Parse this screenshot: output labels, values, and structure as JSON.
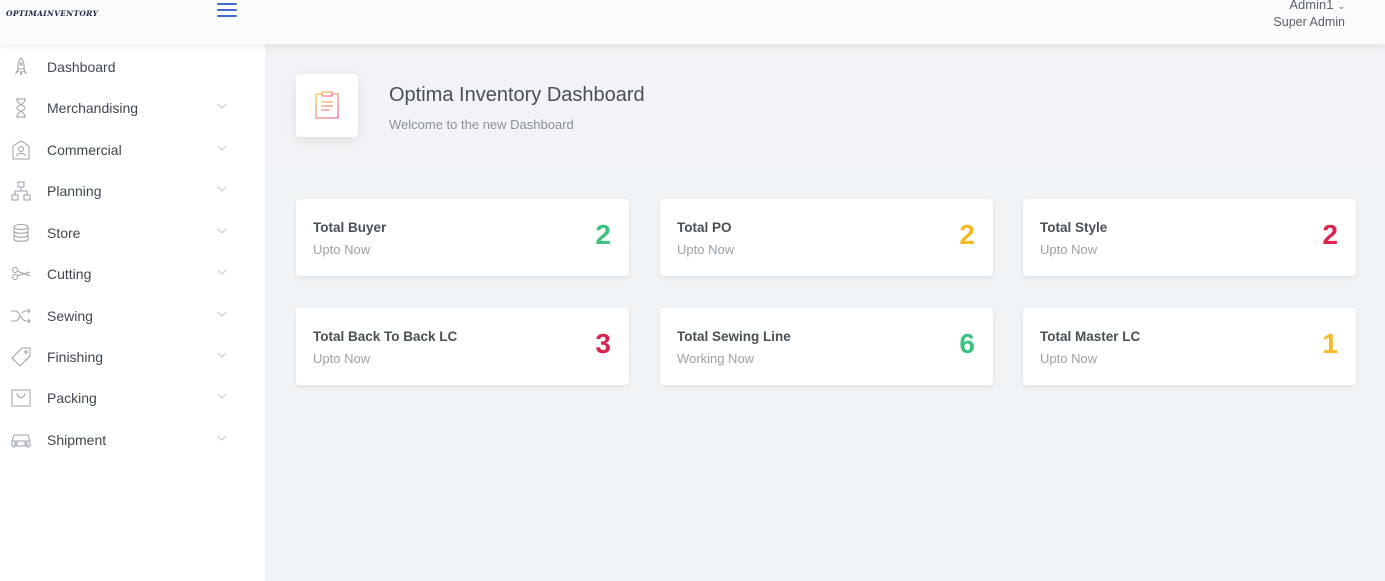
{
  "header": {
    "logo_text": "OPTIMAINVENTORY",
    "user_name": "Admin1",
    "user_role": "Super Admin"
  },
  "sidebar": {
    "items": [
      {
        "label": "Dashboard",
        "icon": "rocket-icon",
        "expandable": false
      },
      {
        "label": "Merchandising",
        "icon": "hourglass-icon",
        "expandable": true
      },
      {
        "label": "Commercial",
        "icon": "id-card-icon",
        "expandable": true
      },
      {
        "label": "Planning",
        "icon": "hierarchy-icon",
        "expandable": true
      },
      {
        "label": "Store",
        "icon": "database-icon",
        "expandable": true
      },
      {
        "label": "Cutting",
        "icon": "scissors-icon",
        "expandable": true
      },
      {
        "label": "Sewing",
        "icon": "shuffle-icon",
        "expandable": true
      },
      {
        "label": "Finishing",
        "icon": "tag-icon",
        "expandable": true
      },
      {
        "label": "Packing",
        "icon": "bag-icon",
        "expandable": true
      },
      {
        "label": "Shipment",
        "icon": "car-icon",
        "expandable": true
      }
    ]
  },
  "page": {
    "title": "Optima Inventory Dashboard",
    "subtitle": "Welcome to the new Dashboard",
    "icon": "clipboard-icon"
  },
  "cards": [
    {
      "title": "Total Buyer",
      "subtitle": "Upto Now",
      "value": "2",
      "color": "#3ac47d"
    },
    {
      "title": "Total PO",
      "subtitle": "Upto Now",
      "value": "2",
      "color": "#f7b924"
    },
    {
      "title": "Total Style",
      "subtitle": "Upto Now",
      "value": "2",
      "color": "#d92550"
    },
    {
      "title": "Total Back To Back LC",
      "subtitle": "Upto Now",
      "value": "3",
      "color": "#d92550"
    },
    {
      "title": "Total Sewing Line",
      "subtitle": "Working Now",
      "value": "6",
      "color": "#3ac47d"
    },
    {
      "title": "Total Master LC",
      "subtitle": "Upto Now",
      "value": "1",
      "color": "#f7b924"
    }
  ],
  "colors": {
    "accent": "#3f6ad8",
    "success": "#3ac47d",
    "warning": "#f7b924",
    "danger": "#d92550"
  }
}
